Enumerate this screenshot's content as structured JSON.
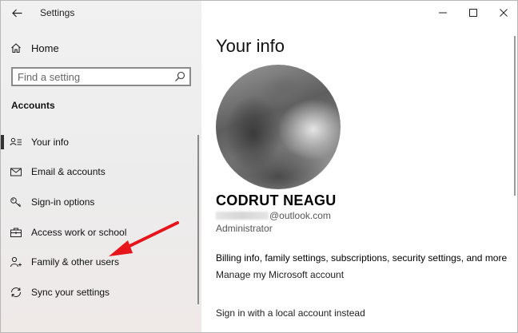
{
  "window": {
    "title": "Settings"
  },
  "sidebar": {
    "home_label": "Home",
    "search_placeholder": "Find a setting",
    "section_title": "Accounts",
    "items": [
      {
        "label": "Your info",
        "icon": "person-card-icon",
        "active": true
      },
      {
        "label": "Email & accounts",
        "icon": "mail-icon"
      },
      {
        "label": "Sign-in options",
        "icon": "key-icon"
      },
      {
        "label": "Access work or school",
        "icon": "briefcase-icon"
      },
      {
        "label": "Family & other users",
        "icon": "person-icon"
      },
      {
        "label": "Sync your settings",
        "icon": "sync-icon"
      }
    ]
  },
  "main": {
    "title": "Your info",
    "user_name": "CODRUT NEAGU",
    "email_domain": "@outlook.com",
    "role": "Administrator",
    "billing_text": "Billing info, family settings, subscriptions, security settings, and more",
    "manage_link": "Manage my Microsoft account",
    "local_account_link": "Sign in with a local account instead"
  },
  "colors": {
    "annotation_arrow": "#e8141b",
    "sidebar_bg": "#f1f1f1"
  }
}
